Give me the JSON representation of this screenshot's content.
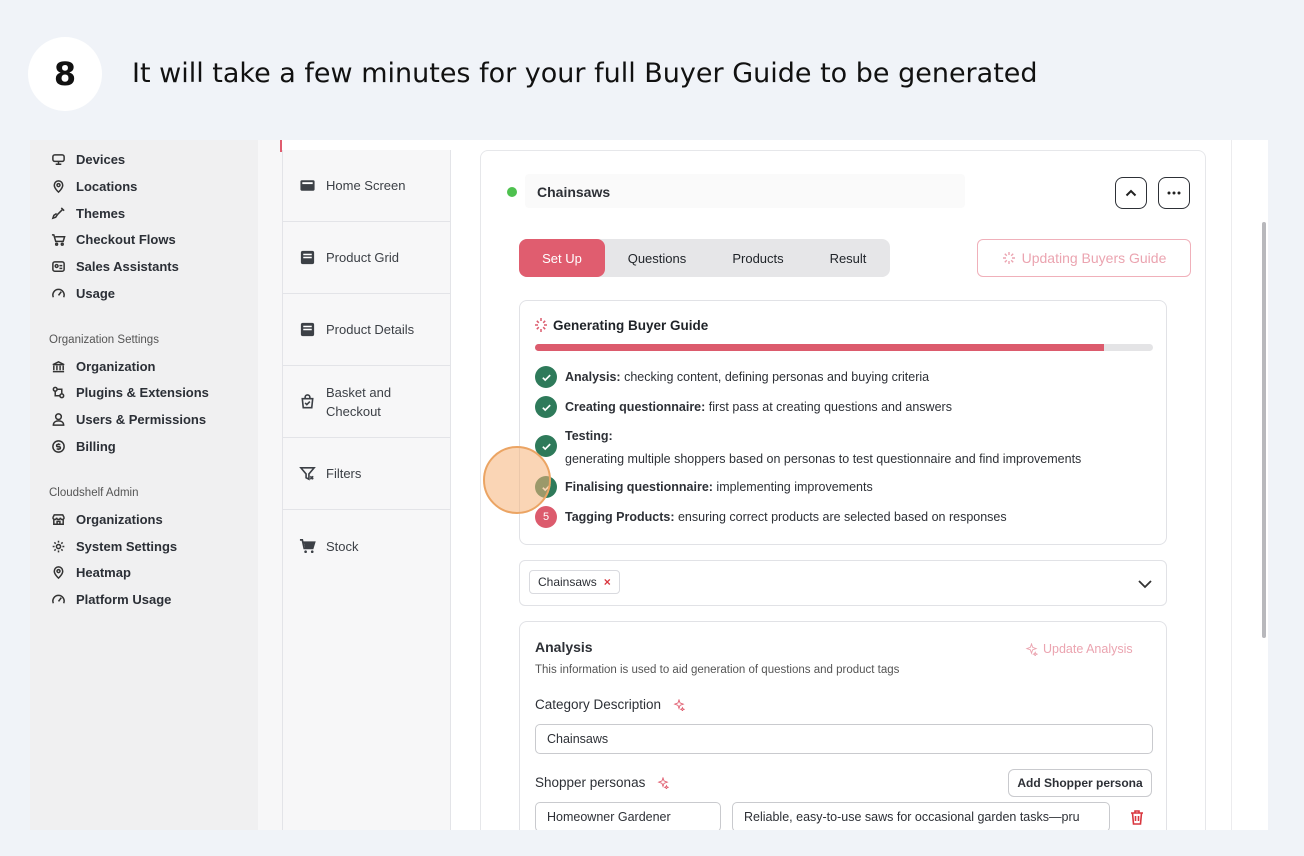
{
  "step": {
    "number": "8",
    "title": "It will take a few minutes for your full Buyer Guide to be generated"
  },
  "sidebar": {
    "items_top": [
      {
        "label": "Devices",
        "icon": "devices-icon"
      },
      {
        "label": "Locations",
        "icon": "location-pin-icon"
      },
      {
        "label": "Themes",
        "icon": "brush-icon"
      },
      {
        "label": "Checkout Flows",
        "icon": "cart-flow-icon"
      },
      {
        "label": "Sales Assistants",
        "icon": "id-card-icon"
      },
      {
        "label": "Usage",
        "icon": "gauge-icon"
      }
    ],
    "org_section_title": "Organization Settings",
    "items_org": [
      {
        "label": "Organization",
        "icon": "bank-icon"
      },
      {
        "label": "Plugins & Extensions",
        "icon": "plugin-icon"
      },
      {
        "label": "Users & Permissions",
        "icon": "user-icon"
      },
      {
        "label": "Billing",
        "icon": "dollar-circle-icon"
      }
    ],
    "admin_section_title": "Cloudshelf Admin",
    "items_admin": [
      {
        "label": "Organizations",
        "icon": "store-icon"
      },
      {
        "label": "System Settings",
        "icon": "gear-icon"
      },
      {
        "label": "Heatmap",
        "icon": "location-pin-icon"
      },
      {
        "label": "Platform Usage",
        "icon": "gauge-icon"
      }
    ]
  },
  "menu": [
    {
      "label": "Home Screen",
      "icon": "home-screen-icon"
    },
    {
      "label": "Product Grid",
      "icon": "grid-icon"
    },
    {
      "label": "Product Details",
      "icon": "details-icon"
    },
    {
      "label": "Basket and\nCheckout",
      "icon": "basket-icon"
    },
    {
      "label": "Filters",
      "icon": "filter-icon"
    },
    {
      "label": "Stock",
      "icon": "cart-icon"
    }
  ],
  "category": {
    "name": "Chainsaws",
    "status_color": "#4ec14f"
  },
  "tabs": [
    "Set Up",
    "Questions",
    "Products",
    "Result"
  ],
  "active_tab": "Set Up",
  "update_button": "Updating Buyers Guide",
  "generating": {
    "title": "Generating Buyer Guide",
    "progress": 0.92,
    "steps": [
      {
        "bold": "Analysis:",
        "text": " checking content, defining personas and buying criteria",
        "status": "done"
      },
      {
        "bold": "Creating questionnaire:",
        "text": " first pass at creating questions and answers",
        "status": "done"
      },
      {
        "bold": "Testing:",
        "text": "generating multiple shoppers based on personas to test questionnaire and find improvements",
        "status": "done"
      },
      {
        "bold": "Finalising questionnaire:",
        "text": " implementing improvements",
        "status": "done"
      },
      {
        "bold": "Tagging Products:",
        "text": " ensuring correct products are selected based on responses",
        "status": "5"
      }
    ]
  },
  "chip": {
    "label": "Chainsaws",
    "remove": "×"
  },
  "analysis": {
    "title": "Analysis",
    "subtitle": "This information is used to aid generation of questions and product tags",
    "update_label": "Update Analysis",
    "category_description_label": "Category Description",
    "category_description_value": "Chainsaws",
    "personas_label": "Shopper personas",
    "add_persona_label": "Add Shopper persona",
    "persona_name": "Homeowner Gardener",
    "persona_desc": "Reliable, easy-to-use saws for occasional garden tasks—pru"
  },
  "colors": {
    "accent": "#e05d6f",
    "success": "#2e7a5a"
  }
}
